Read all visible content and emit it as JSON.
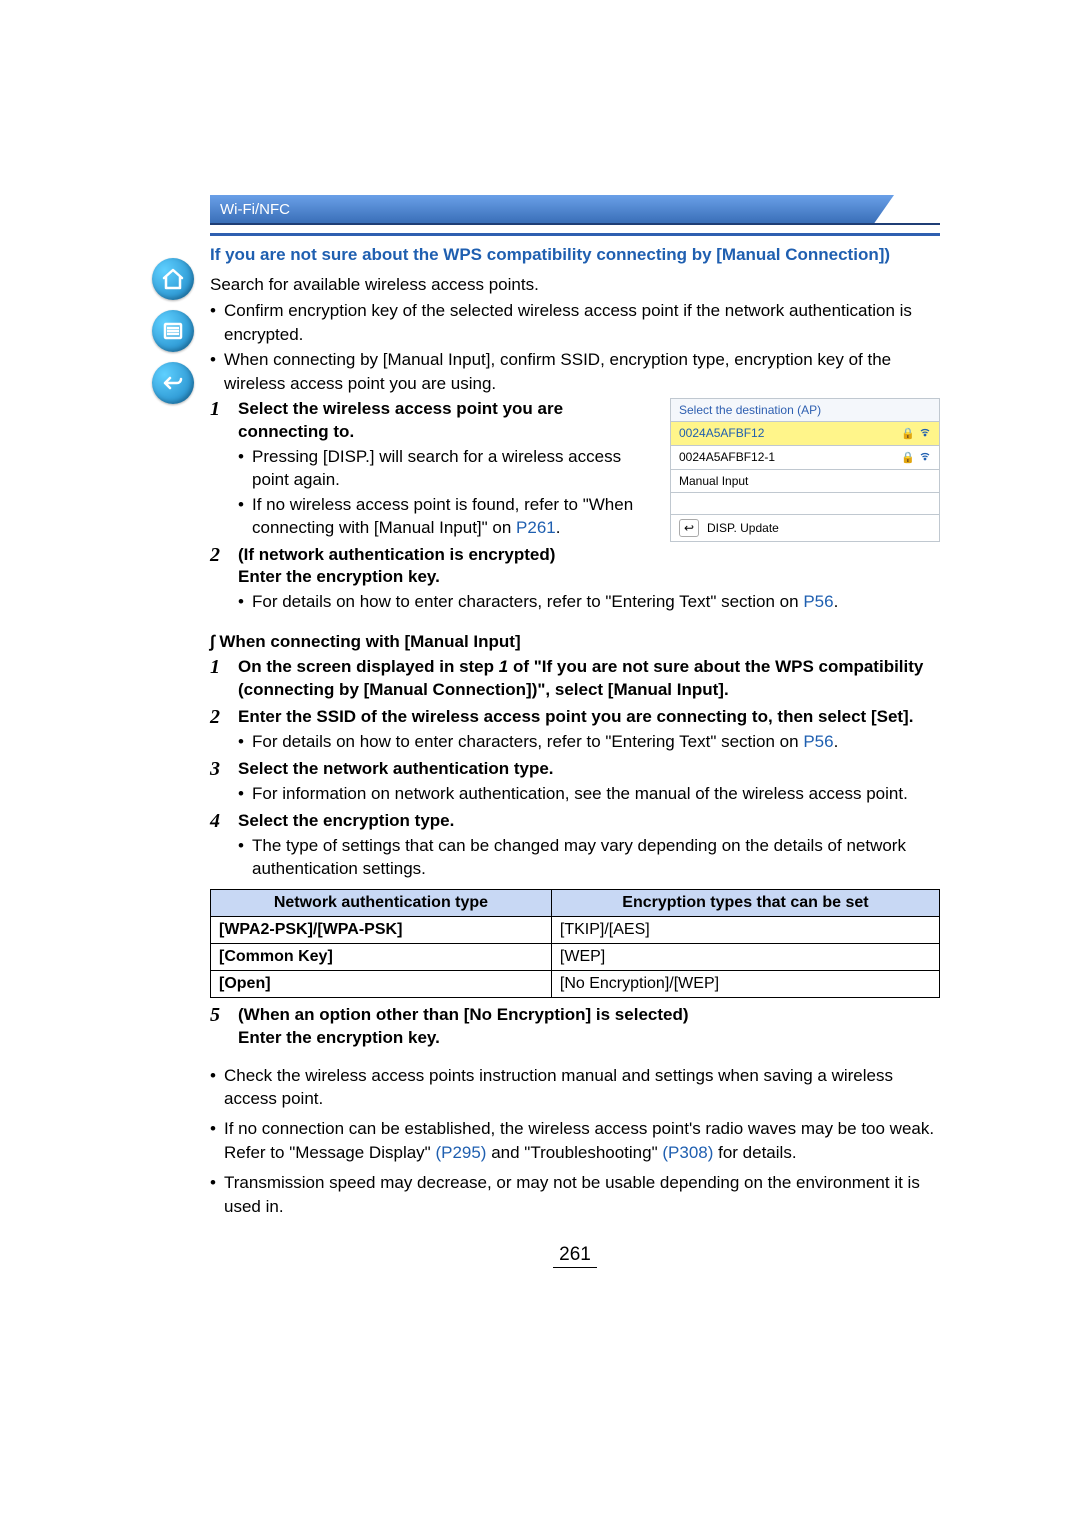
{
  "header": {
    "breadcrumb": "Wi-Fi/NFC"
  },
  "section_title": "If you are not sure about the WPS compatibility connecting by [Manual Connection])",
  "intro": "Search for available wireless access points.",
  "intro_bullets": [
    "Confirm encryption key of the selected wireless access point if the network authentication is encrypted.",
    "When connecting by [Manual Input], confirm SSID, encryption type, encryption key of the wireless access point you are using."
  ],
  "ap_panel": {
    "title": "Select the destination (AP)",
    "rows": [
      {
        "ssid": "0024A5AFBF12",
        "lock": true,
        "wifi": true,
        "selected": true
      },
      {
        "ssid": "0024A5AFBF12-1",
        "lock": true,
        "wifi": true,
        "selected": false
      },
      {
        "ssid": "Manual Input",
        "lock": false,
        "wifi": false,
        "selected": false
      }
    ],
    "footer_label": "DISP. Update"
  },
  "steps1": [
    {
      "num": "1",
      "title": "Select the wireless access point you are connecting to.",
      "subs": [
        {
          "text": "Pressing [DISP.] will search for a wireless access point again."
        },
        {
          "text_before": "If no wireless access point is found, refer to \"When connecting with [Manual Input]\" on ",
          "link": "P261",
          "text_after": "."
        }
      ]
    },
    {
      "num": "2",
      "title": "(If network authentication is encrypted)\nEnter the encryption key.",
      "subs": [
        {
          "text_before": "For details on how to enter characters, refer to \"Entering Text\" section on ",
          "link": "P56",
          "text_after": "."
        }
      ]
    }
  ],
  "subhead": "When connecting with [Manual Input]",
  "steps2": [
    {
      "num": "1",
      "title_html": "On the screen displayed in step <i>1</i> of \"If you are not sure about the WPS compatibility (connecting by [Manual Connection])\", select [Manual Input]."
    },
    {
      "num": "2",
      "title": "Enter the SSID of the wireless access point you are connecting to, then select [Set].",
      "subs": [
        {
          "text_before": "For details on how to enter characters, refer to \"Entering Text\" section on ",
          "link": "P56",
          "text_after": "."
        }
      ]
    },
    {
      "num": "3",
      "title": "Select the network authentication type.",
      "subs": [
        {
          "text": "For information on network authentication, see the manual of the wireless access point."
        }
      ]
    },
    {
      "num": "4",
      "title": "Select the encryption type.",
      "subs": [
        {
          "text": "The type of settings that can be changed may vary depending on the details of network authentication settings."
        }
      ]
    }
  ],
  "table": {
    "headers": [
      "Network authentication type",
      "Encryption types that can be set"
    ],
    "rows": [
      [
        "[WPA2-PSK]/[WPA-PSK]",
        "[TKIP]/[AES]"
      ],
      [
        "[Common Key]",
        "[WEP]"
      ],
      [
        "[Open]",
        "[No Encryption]/[WEP]"
      ]
    ]
  },
  "step5": {
    "num": "5",
    "title": "(When an option other than [No Encryption] is selected)\nEnter the encryption key."
  },
  "notes": [
    {
      "text": "Check the wireless access points instruction manual and settings when saving a wireless access point."
    },
    {
      "text_before": "If no connection can be established, the wireless access point's radio waves may be too weak. Refer to \"Message Display\" ",
      "link1": "(P295)",
      "middle": " and \"Troubleshooting\" ",
      "link2": "(P308)",
      "text_after": " for details."
    },
    {
      "text": "Transmission speed may decrease, or may not be usable depending on the environment it is used in."
    }
  ],
  "page_number": "261"
}
